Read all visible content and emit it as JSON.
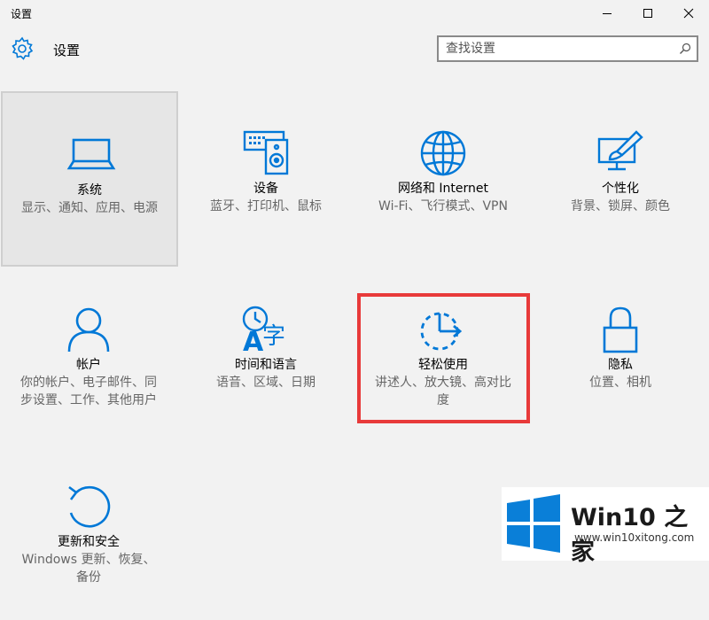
{
  "window": {
    "title": "设置"
  },
  "header": {
    "title": "设置"
  },
  "search": {
    "placeholder": "查找设置"
  },
  "colors": {
    "accent": "#0078d7",
    "highlight": "#e83a3a"
  },
  "tiles": [
    {
      "name": "系统",
      "desc": "显示、通知、应用、电源",
      "icon": "laptop-icon"
    },
    {
      "name": "设备",
      "desc": "蓝牙、打印机、鼠标",
      "icon": "keyboard-speaker-icon"
    },
    {
      "name": "网络和 Internet",
      "desc": "Wi-Fi、飞行模式、VPN",
      "icon": "globe-icon"
    },
    {
      "name": "个性化",
      "desc": "背景、锁屏、颜色",
      "icon": "paintbrush-monitor-icon"
    },
    {
      "name": "帐户",
      "desc": "你的帐户、电子邮件、同步设置、工作、其他用户",
      "icon": "person-icon"
    },
    {
      "name": "时间和语言",
      "desc": "语音、区域、日期",
      "icon": "clock-language-icon"
    },
    {
      "name": "轻松使用",
      "desc": "讲述人、放大镜、高对比度",
      "icon": "ease-of-access-icon"
    },
    {
      "name": "隐私",
      "desc": "位置、相机",
      "icon": "lock-icon"
    },
    {
      "name": "更新和安全",
      "desc": "Windows 更新、恢复、备份",
      "icon": "update-icon"
    }
  ],
  "watermark": {
    "brand": "Win10 之家",
    "url": "www.win10xitong.com"
  }
}
